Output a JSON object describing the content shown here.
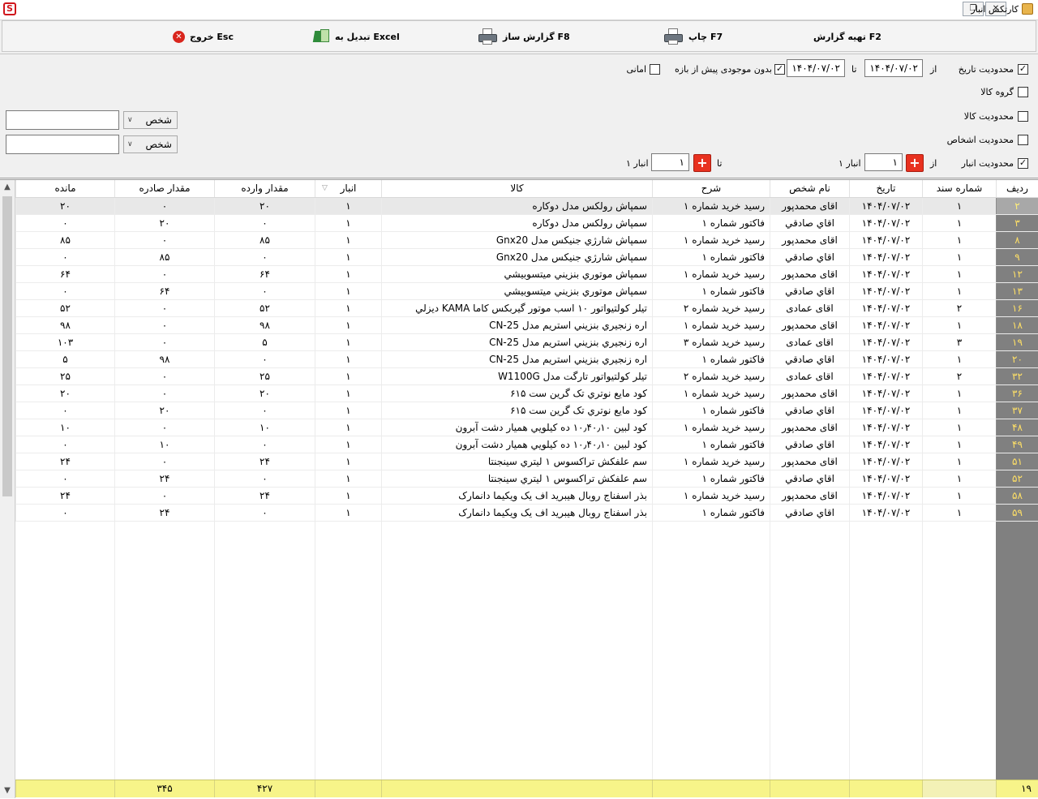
{
  "window": {
    "title": "کارتکس انبار",
    "logo_letter": "S"
  },
  "toolbar": {
    "prepare_report": "تهیه گزارش  F2",
    "print": "چاپ  F7",
    "report_builder": "گزارش ساز  F8",
    "excel": "تبدیل به Excel",
    "exit": "خروج Esc"
  },
  "filters": {
    "date_limit_label": "محدودیت تاریخ",
    "date_limit_checked": true,
    "from_label": "از",
    "to_label": "تا",
    "date_from": "۱۴۰۴/۰۷/۰۲",
    "date_to": "۱۴۰۴/۰۷/۰۲",
    "no_prior_stock_label": "بدون موجودی پیش از بازه",
    "no_prior_stock_checked": true,
    "amani_label": "امانی",
    "amani_checked": false,
    "goods_group_label": "گروه کالا",
    "goods_group_checked": false,
    "goods_limit_label": "محدودیت کالا",
    "goods_limit_checked": false,
    "persons_limit_label": "محدودیت اشخاص",
    "persons_limit_checked": false,
    "warehouse_limit_label": "محدودیت انبار",
    "warehouse_limit_checked": true,
    "warehouse_from_label": "از",
    "warehouse_to_label": "تا",
    "warehouse_from_value": "۱",
    "warehouse_to_value": "۱",
    "warehouse_from_name": "انبار ۱",
    "warehouse_to_name": "انبار ۱",
    "person_combo_1": "شخص",
    "person_combo_2": "شخص"
  },
  "grid": {
    "columns": {
      "radif": "ردیف",
      "doc_no": "شماره سند",
      "date": "تاریخ",
      "person": "نام شخص",
      "desc": "شرح",
      "goods": "کالا",
      "warehouse": "انبار",
      "in_qty": "مقدار وارده",
      "out_qty": "مقدار صادره",
      "remain": "مانده"
    },
    "rows": [
      {
        "radif": "۲",
        "doc": "۱",
        "date": "۱۴۰۴/۰۷/۰۲",
        "person": "اقای محمدپور",
        "desc": "رسید خرید شماره  ۱",
        "goods": "سمپاش رولکس مدل دوکاره",
        "wh": "۱",
        "in": "۲۰",
        "out": "۰",
        "remain": "۲۰"
      },
      {
        "radif": "۳",
        "doc": "۱",
        "date": "۱۴۰۴/۰۷/۰۲",
        "person": "اقاي  صادقي",
        "desc": "فاکتور شماره ۱",
        "goods": "سمپاش رولکس مدل دوکاره",
        "wh": "۱",
        "in": "۰",
        "out": "۲۰",
        "remain": "۰"
      },
      {
        "radif": "۸",
        "doc": "۱",
        "date": "۱۴۰۴/۰۷/۰۲",
        "person": "اقای محمدپور",
        "desc": "رسید خرید شماره  ۱",
        "goods": "سمپاش شارژي جنيكس مدل Gnx20",
        "wh": "۱",
        "in": "۸۵",
        "out": "۰",
        "remain": "۸۵"
      },
      {
        "radif": "۹",
        "doc": "۱",
        "date": "۱۴۰۴/۰۷/۰۲",
        "person": "اقاي  صادقي",
        "desc": "فاکتور شماره ۱",
        "goods": "سمپاش شارژي جنيكس مدل Gnx20",
        "wh": "۱",
        "in": "۰",
        "out": "۸۵",
        "remain": "۰"
      },
      {
        "radif": "۱۲",
        "doc": "۱",
        "date": "۱۴۰۴/۰۷/۰۲",
        "person": "اقای محمدپور",
        "desc": "رسید خرید شماره  ۱",
        "goods": "سمپاش موتوري بنزيني ميتسوبيشي",
        "wh": "۱",
        "in": "۶۴",
        "out": "۰",
        "remain": "۶۴"
      },
      {
        "radif": "۱۳",
        "doc": "۱",
        "date": "۱۴۰۴/۰۷/۰۲",
        "person": "اقاي  صادقي",
        "desc": "فاکتور شماره ۱",
        "goods": "سمپاش موتوري بنزيني ميتسوبيشي",
        "wh": "۱",
        "in": "۰",
        "out": "۶۴",
        "remain": "۰"
      },
      {
        "radif": "۱۶",
        "doc": "۲",
        "date": "۱۴۰۴/۰۷/۰۲",
        "person": "اقای عمادی",
        "desc": "رسید خرید شماره  ۲",
        "goods": "تيلر كولتيواتور ۱۰ اسب موتور گيربكس كاما KAMA ديزلي",
        "wh": "۱",
        "in": "۵۲",
        "out": "۰",
        "remain": "۵۲"
      },
      {
        "radif": "۱۸",
        "doc": "۱",
        "date": "۱۴۰۴/۰۷/۰۲",
        "person": "اقای محمدپور",
        "desc": "رسید خرید شماره  ۱",
        "goods": "اره زنجيري بنزيني استريم مدل CN-25",
        "wh": "۱",
        "in": "۹۸",
        "out": "۰",
        "remain": "۹۸"
      },
      {
        "radif": "۱۹",
        "doc": "۳",
        "date": "۱۴۰۴/۰۷/۰۲",
        "person": "اقای عمادی",
        "desc": "رسید خرید شماره  ۳",
        "goods": "اره زنجيري بنزيني استريم مدل CN-25",
        "wh": "۱",
        "in": "۵",
        "out": "۰",
        "remain": "۱۰۳"
      },
      {
        "radif": "۲۰",
        "doc": "۱",
        "date": "۱۴۰۴/۰۷/۰۲",
        "person": "اقاي  صادقي",
        "desc": "فاکتور شماره ۱",
        "goods": "اره زنجيري بنزيني استريم مدل CN-25",
        "wh": "۱",
        "in": "۰",
        "out": "۹۸",
        "remain": "۵"
      },
      {
        "radif": "۳۲",
        "doc": "۲",
        "date": "۱۴۰۴/۰۷/۰۲",
        "person": "اقای عمادی",
        "desc": "رسید خرید شماره  ۲",
        "goods": "تيلر كولتيواتور تارگت مدل W1100G",
        "wh": "۱",
        "in": "۲۵",
        "out": "۰",
        "remain": "۲۵"
      },
      {
        "radif": "۳۶",
        "doc": "۱",
        "date": "۱۴۰۴/۰۷/۰۲",
        "person": "اقای محمدپور",
        "desc": "رسید خرید شماره  ۱",
        "goods": "كود مايع نوتري تک گرين ست ۶۱۵",
        "wh": "۱",
        "in": "۲۰",
        "out": "۰",
        "remain": "۲۰"
      },
      {
        "radif": "۳۷",
        "doc": "۱",
        "date": "۱۴۰۴/۰۷/۰۲",
        "person": "اقاي  صادقي",
        "desc": "فاکتور شماره ۱",
        "goods": "كود مايع نوتري تک گرين ست ۶۱۵",
        "wh": "۱",
        "in": "۰",
        "out": "۲۰",
        "remain": "۰"
      },
      {
        "radif": "۴۸",
        "doc": "۱",
        "date": "۱۴۰۴/۰۷/۰۲",
        "person": "اقای محمدپور",
        "desc": "رسید خرید شماره  ۱",
        "goods": "كود لبين ۱۰٫۴۰٫۱۰ ده كيلويي هميار دشت آبرون",
        "wh": "۱",
        "in": "۱۰",
        "out": "۰",
        "remain": "۱۰"
      },
      {
        "radif": "۴۹",
        "doc": "۱",
        "date": "۱۴۰۴/۰۷/۰۲",
        "person": "اقاي  صادقي",
        "desc": "فاکتور شماره ۱",
        "goods": "كود لبين ۱۰٫۴۰٫۱۰ ده كيلويي هميار دشت آبرون",
        "wh": "۱",
        "in": "۰",
        "out": "۱۰",
        "remain": "۰"
      },
      {
        "radif": "۵۱",
        "doc": "۱",
        "date": "۱۴۰۴/۰۷/۰۲",
        "person": "اقای محمدپور",
        "desc": "رسید خرید شماره  ۱",
        "goods": "سم علفكش تراكسوس ۱ ليتري سينجنتا",
        "wh": "۱",
        "in": "۲۴",
        "out": "۰",
        "remain": "۲۴"
      },
      {
        "radif": "۵۲",
        "doc": "۱",
        "date": "۱۴۰۴/۰۷/۰۲",
        "person": "اقاي  صادقي",
        "desc": "فاکتور شماره ۱",
        "goods": "سم علفكش تراكسوس ۱ ليتري سينجنتا",
        "wh": "۱",
        "in": "۰",
        "out": "۲۴",
        "remain": "۰"
      },
      {
        "radif": "۵۸",
        "doc": "۱",
        "date": "۱۴۰۴/۰۷/۰۲",
        "person": "اقای محمدپور",
        "desc": "رسید خرید شماره  ۱",
        "goods": "بذر اسفناج روبال هيبريد اف يک ويكيما دانمارک",
        "wh": "۱",
        "in": "۲۴",
        "out": "۰",
        "remain": "۲۴"
      },
      {
        "radif": "۵۹",
        "doc": "۱",
        "date": "۱۴۰۴/۰۷/۰۲",
        "person": "اقاي  صادقي",
        "desc": "فاکتور شماره ۱",
        "goods": "بذر اسفناج روبال هيبريد اف يک ويكيما دانمارک",
        "wh": "۱",
        "in": "۰",
        "out": "۲۴",
        "remain": "۰"
      }
    ],
    "footer": {
      "count": "۱۹",
      "in_total": "۴۲۷",
      "out_total": "۳۴۵"
    }
  },
  "colors": {
    "radif_bg": "#808080",
    "radif_text": "#ffe066",
    "footer_bg": "#f7f489",
    "exit_red": "#d9251d"
  }
}
